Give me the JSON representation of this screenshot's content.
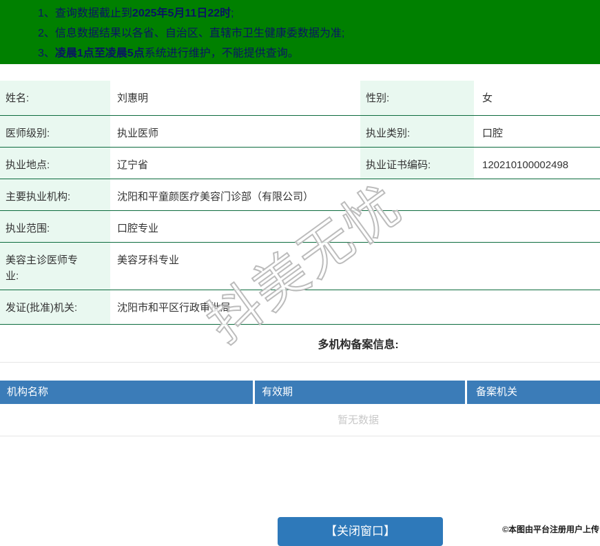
{
  "banner": {
    "bg_color": "#008000",
    "text_color": "#0a1464",
    "notices": [
      {
        "num": "1、",
        "pre": "查询数据截止到",
        "bold": "2025年5月11日22时",
        "post": ";"
      },
      {
        "num": "2、",
        "pre": "信息数据结果以各省、自治区、直辖市卫生健康委数据为准;",
        "bold": "",
        "post": ""
      },
      {
        "num": "3、",
        "pre": "",
        "bold": "凌晨1点至凌晨5点",
        "post": "系统进行维护，不能提供查询。"
      }
    ]
  },
  "info": {
    "label_bg": "#e9f8f0",
    "row_border_color": "#0a6a3c",
    "name_label": "姓名:",
    "name_value": "刘惠明",
    "gender_label": "性别:",
    "gender_value": "女",
    "level_label": "医师级别:",
    "level_value": "执业医师",
    "category_label": "执业类别:",
    "category_value": "口腔",
    "place_label": "执业地点:",
    "place_value": "辽宁省",
    "cert_label": "执业证书编码:",
    "cert_value": "120210100002498",
    "org_label": "主要执业机构:",
    "org_value": "沈阳和平童颜医疗美容门诊部（有限公司）",
    "scope_label": "执业范围:",
    "scope_value": "口腔专业",
    "cosmetic_label": "美容主诊医师专业:",
    "cosmetic_value": "美容牙科专业",
    "issuer_label": "发证(批准)机关:",
    "issuer_value": "沈阳市和平区行政审批局"
  },
  "multi_org": {
    "section_title": "多机构备案信息:",
    "header_bg": "#3b7cb8",
    "headers": [
      "机构名称",
      "有效期",
      "备案机关"
    ],
    "empty_text": "暂无数据",
    "rows": []
  },
  "watermark": {
    "text": "抖美无忧"
  },
  "footer": {
    "close_button_label": "【关闭窗口】",
    "button_color": "#2e79ba",
    "copyright": "©本图由平台注册用户上传"
  }
}
